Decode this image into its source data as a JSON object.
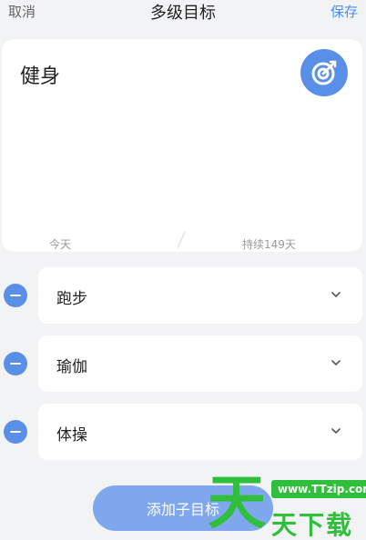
{
  "header": {
    "cancel_label": "取消",
    "title": "多级目标",
    "save_label": "保存"
  },
  "goal": {
    "name": "健身",
    "badge_icon": "target-arrow-icon",
    "start_label": "今天",
    "duration_label": "持续149天"
  },
  "sub_goals": [
    {
      "label": "跑步"
    },
    {
      "label": "瑜伽"
    },
    {
      "label": "体操"
    }
  ],
  "add_button_label": "添加子目标",
  "watermark": {
    "big": "天",
    "url": "www.TTzip.com",
    "text": "天下载"
  },
  "colors": {
    "accent": "#5a8fe8",
    "add_button": "#7ea7ee",
    "watermark": "#2fbf3a"
  }
}
